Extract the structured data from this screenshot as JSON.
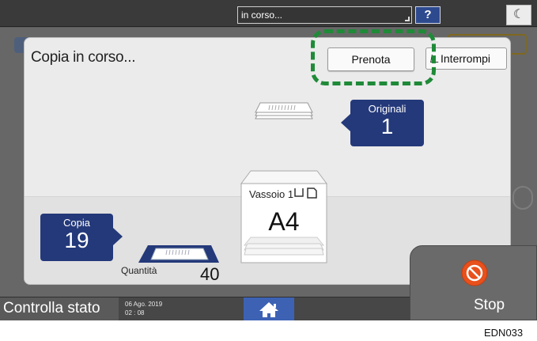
{
  "topbar": {
    "status_text": "in corso...",
    "help_label": "?",
    "moon_icon": "moon-icon"
  },
  "dialog": {
    "title": "Copia in corso...",
    "prenota_label": "Prenota",
    "interrompi_label": "Interrompi",
    "originals": {
      "label": "Originali",
      "count": "1"
    },
    "copies": {
      "label": "Copia",
      "count": "19"
    },
    "tray": {
      "label": "Vassoio 1",
      "paper_size": "A4"
    },
    "quantity": {
      "label": "Quantità",
      "value": "40"
    }
  },
  "bottombar": {
    "status_check_label": "Controlla stato",
    "date": "06 Ago. 2019",
    "time": "02 : 08"
  },
  "stop": {
    "label": "Stop"
  },
  "caption": "EDN033",
  "colors": {
    "accent_navy": "#24397a",
    "home_blue": "#3d62b4",
    "stop_orange": "#e8501c",
    "highlight_green": "#1f8a38"
  }
}
